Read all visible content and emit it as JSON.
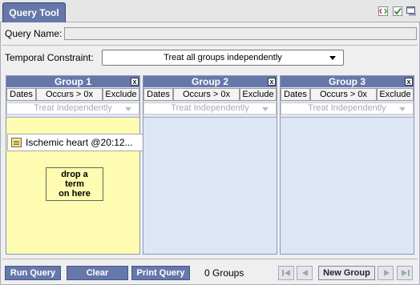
{
  "tab": {
    "label": "Query Tool"
  },
  "toolbar_icons": [
    "xml-icon",
    "check-icon",
    "window-icon"
  ],
  "query_name": {
    "label": "Query Name:",
    "value": ""
  },
  "temporal": {
    "label": "Temporal Constraint:",
    "value": "Treat all groups independently"
  },
  "groups": [
    {
      "title": "Group 1",
      "buttons": [
        "Dates",
        "Occurs > 0x",
        "Exclude"
      ],
      "timing": "Treat Independently",
      "concept": "Ischemic heart @20:12...",
      "drop_text": "drop a term on here",
      "highlight": "#fdfcb0"
    },
    {
      "title": "Group 2",
      "buttons": [
        "Dates",
        "Occurs > 0x",
        "Exclude"
      ],
      "timing": "Treat Independently"
    },
    {
      "title": "Group 3",
      "buttons": [
        "Dates",
        "Occurs > 0x",
        "Exclude"
      ],
      "timing": "Treat Independently"
    }
  ],
  "footer": {
    "run_label": "Run Query",
    "clear_label": "Clear",
    "print_label": "Print Query",
    "group_count": "0 Groups",
    "new_group_label": "New Group"
  },
  "colors": {
    "header": "#6677aa",
    "group_body": "#dde6f7",
    "active_group_body": "#fdfcb0"
  }
}
